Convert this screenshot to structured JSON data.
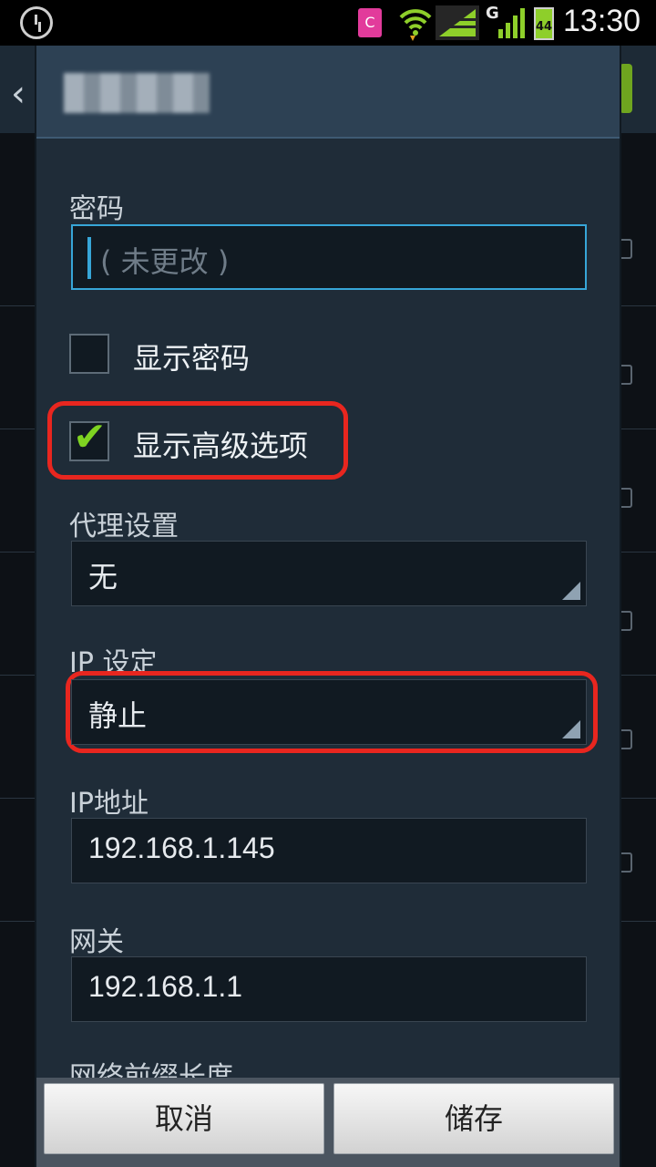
{
  "status_bar": {
    "time": "13:30",
    "battery_level": "44",
    "network_type": "G",
    "sim_label": "C",
    "icons": [
      "alarm-icon",
      "sim-icon",
      "wifi-icon",
      "signal-icon",
      "signal-icon",
      "battery-icon"
    ]
  },
  "dialog": {
    "password_label": "密码",
    "password_placeholder": "( 未更改 )",
    "show_password_label": "显示密码",
    "show_password_checked": false,
    "show_advanced_label": "显示高级选项",
    "show_advanced_checked": true,
    "proxy_label": "代理设置",
    "proxy_value": "无",
    "ip_settings_label": "IP 设定",
    "ip_settings_value": "静止",
    "ip_address_label": "IP地址",
    "ip_address_value": "192.168.1.145",
    "gateway_label": "网关",
    "gateway_value": "192.168.1.1",
    "prefix_label": "网络前缀长度",
    "cancel_label": "取消",
    "save_label": "储存"
  },
  "colors": {
    "accent": "#37a6d8",
    "highlight": "#e8261f",
    "check": "#7ed321"
  }
}
